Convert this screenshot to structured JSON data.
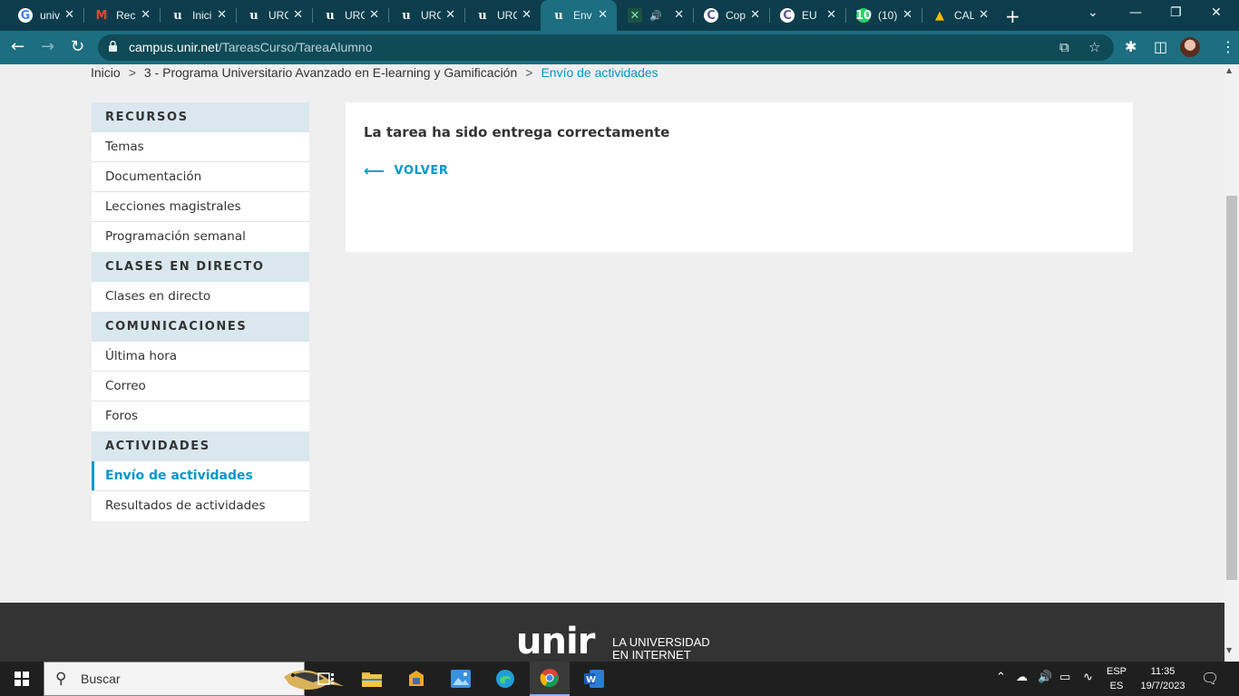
{
  "browser": {
    "tabs": [
      {
        "title": "univ",
        "icon": "google-icon",
        "glyph": "G"
      },
      {
        "title": "Rec",
        "icon": "gmail-icon",
        "glyph": "M"
      },
      {
        "title": "Inici",
        "icon": "unir-icon",
        "glyph": "u"
      },
      {
        "title": "URC",
        "icon": "unir-icon",
        "glyph": "u"
      },
      {
        "title": "URC",
        "icon": "unir-icon",
        "glyph": "u"
      },
      {
        "title": "URC",
        "icon": "unir-icon",
        "glyph": "u"
      },
      {
        "title": "URC",
        "icon": "unir-icon",
        "glyph": "u"
      },
      {
        "title": "Env",
        "icon": "unir-icon",
        "glyph": "u",
        "active": true
      },
      {
        "title": "",
        "icon": "site-icon",
        "glyph": "✕",
        "audio": true
      },
      {
        "title": "Cop",
        "icon": "copyleaks-icon",
        "glyph": "C"
      },
      {
        "title": "EU",
        "icon": "copyleaks-icon",
        "glyph": "C"
      },
      {
        "title": "(10)",
        "icon": "whatsapp-icon",
        "glyph": "10"
      },
      {
        "title": "CAL",
        "icon": "drive-icon",
        "glyph": "▲"
      }
    ],
    "url_host": "campus.unir.net",
    "url_path": "/TareasCurso/TareaAlumno"
  },
  "breadcrumb": {
    "items": [
      "Inicio",
      "3 - Programa Universitario Avanzado en E-learning y Gamificación"
    ],
    "current": "Envío de actividades",
    "separator": ">"
  },
  "sidebar": {
    "sections": [
      {
        "heading": "RECURSOS",
        "items": [
          "Temas",
          "Documentación",
          "Lecciones magistrales",
          "Programación semanal"
        ]
      },
      {
        "heading": "CLASES EN DIRECTO",
        "items": [
          "Clases en directo"
        ]
      },
      {
        "heading": "COMUNICACIONES",
        "items": [
          "Última hora",
          "Correo",
          "Foros"
        ]
      },
      {
        "heading": "ACTIVIDADES",
        "items": [
          "Envío de actividades",
          "Resultados de actividades"
        ]
      }
    ],
    "active_item": "Envío de actividades"
  },
  "panel": {
    "message": "La tarea ha sido entrega correctamente",
    "back_label": "VOLVER"
  },
  "footer": {
    "logo_text": "unir",
    "tagline_line1": "LA UNIVERSIDAD",
    "tagline_line2": "EN INTERNET"
  },
  "taskbar": {
    "search_placeholder": "Buscar",
    "lang_top": "ESP",
    "lang_bottom": "ES",
    "time": "11:35",
    "date": "19/7/2023"
  },
  "colors": {
    "accent": "#0098cd",
    "tabstrip": "#0d3d4c",
    "toolbar": "#1c6e80",
    "footer": "#333333",
    "sidebar_heading_bg": "#d9e7ee"
  }
}
